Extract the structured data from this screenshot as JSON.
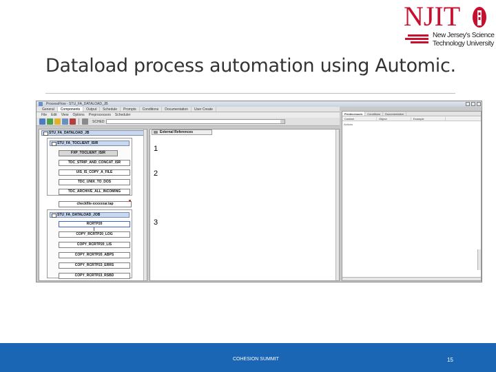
{
  "logo": {
    "letters": "NJIT",
    "line1": "New Jersey's Science &",
    "line2": "Technology University",
    "brand_color": "#c8102e"
  },
  "slide": {
    "title": "Dataload process automation using Automic.",
    "footer": "COHESION SUMMIT",
    "page_number": "15",
    "footer_color": "#1a66b4"
  },
  "window": {
    "title": "ProcessFlow - STU_FA_DATALOAD_JB",
    "tabs": [
      "General",
      "Components",
      "Output",
      "Schedule",
      "Prompts",
      "Conditions",
      "Documentation",
      "User Create"
    ],
    "active_tab": "Components",
    "menu": [
      "File",
      "Edit",
      "View",
      "Options",
      "Preprocessors",
      "Scheduler"
    ],
    "toolbar_combo_label": "SCHED"
  },
  "flow": {
    "workflow_name": "STU_FA_DATALOAD_JB",
    "groups": [
      {
        "name": "STU_FA_TOCLIENT_ISIR",
        "tasks": [
          "FXP_TOCLIENT_ISIR",
          "TDC_STRIP_AND_CONCAT_ISR",
          "UIS_IS_COPY_A_FILE",
          "TDC_UNIX_TO_DOS",
          "TDC_ARCHIVE_ALL_INCOMING"
        ]
      },
      {
        "name": "STU_FA_DATALOAD_JOB",
        "tasks": [
          "RCRTP20",
          "COPY_RCRTP20_LOG",
          "COPY_RCRTP20_LIS",
          "COPY_RCRTP20_ABPS",
          "COPY_RCRTP23_ERRS",
          "COPY_RCRTP23_RSBD"
        ]
      }
    ],
    "checkfile_task": "checkfile-xxxxxxar.tap",
    "external_references_label": "External References",
    "step_labels": [
      "1",
      "2",
      "3"
    ]
  },
  "right_panel": {
    "tabs": [
      "Predecessors",
      "Conditions",
      "Documentation"
    ],
    "columns": [
      "Context",
      "Object",
      "Example"
    ],
    "row_label": "Actions"
  }
}
